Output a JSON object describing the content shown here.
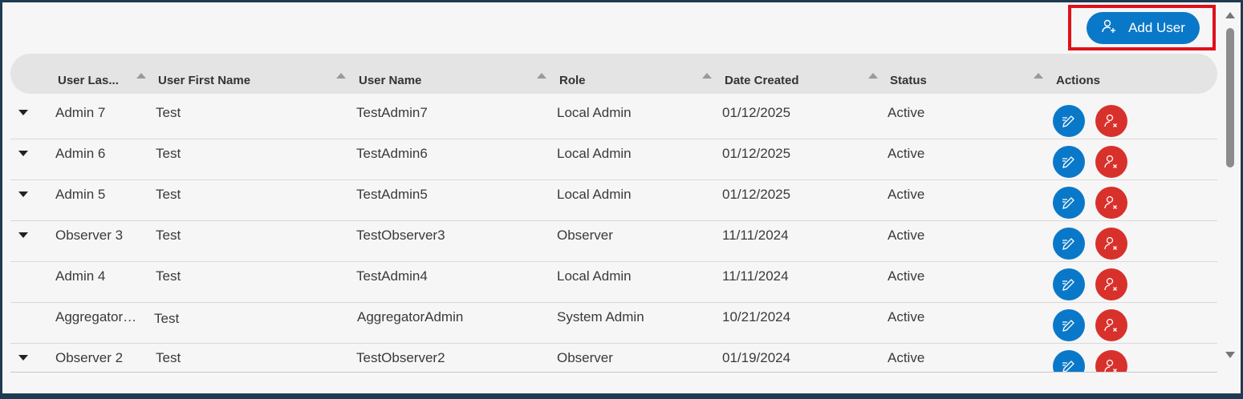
{
  "toolbar": {
    "add_user_label": "Add User"
  },
  "table": {
    "columns": [
      "User Las...",
      "User First Name",
      "User Name",
      "Role",
      "Date Created",
      "Status",
      "Actions"
    ],
    "rows": [
      {
        "last": "Admin 7",
        "first": "Test",
        "username": "TestAdmin7",
        "role": "Local Admin",
        "date": "01/12/2025",
        "status": "Active",
        "expandable": true
      },
      {
        "last": "Admin 6",
        "first": "Test",
        "username": "TestAdmin6",
        "role": "Local Admin",
        "date": "01/12/2025",
        "status": "Active",
        "expandable": true
      },
      {
        "last": "Admin 5",
        "first": "Test",
        "username": "TestAdmin5",
        "role": "Local Admin",
        "date": "01/12/2025",
        "status": "Active",
        "expandable": true
      },
      {
        "last": "Observer 3",
        "first": "Test",
        "username": "TestObserver3",
        "role": "Observer",
        "date": "11/11/2024",
        "status": "Active",
        "expandable": true
      },
      {
        "last": "Admin 4",
        "first": "Test",
        "username": "TestAdmin4",
        "role": "Local Admin",
        "date": "11/11/2024",
        "status": "Active",
        "expandable": false
      },
      {
        "last": "Aggregator…",
        "first": "Test",
        "username": "AggregatorAdmin",
        "role": "System Admin",
        "date": "10/21/2024",
        "status": "Active",
        "expandable": false
      },
      {
        "last": "Observer 2",
        "first": "Test",
        "username": "TestObserver2",
        "role": "Observer",
        "date": "01/19/2024",
        "status": "Active",
        "expandable": true
      }
    ]
  },
  "icons": {
    "add_user": "add-user-icon",
    "edit": "edit-icon",
    "delete_user": "remove-user-icon",
    "sort": "sort-asc-icon",
    "expand": "chevron-down-icon"
  },
  "colors": {
    "primary": "#0a78c8",
    "danger": "#d8312b",
    "highlight": "#e0101a"
  }
}
